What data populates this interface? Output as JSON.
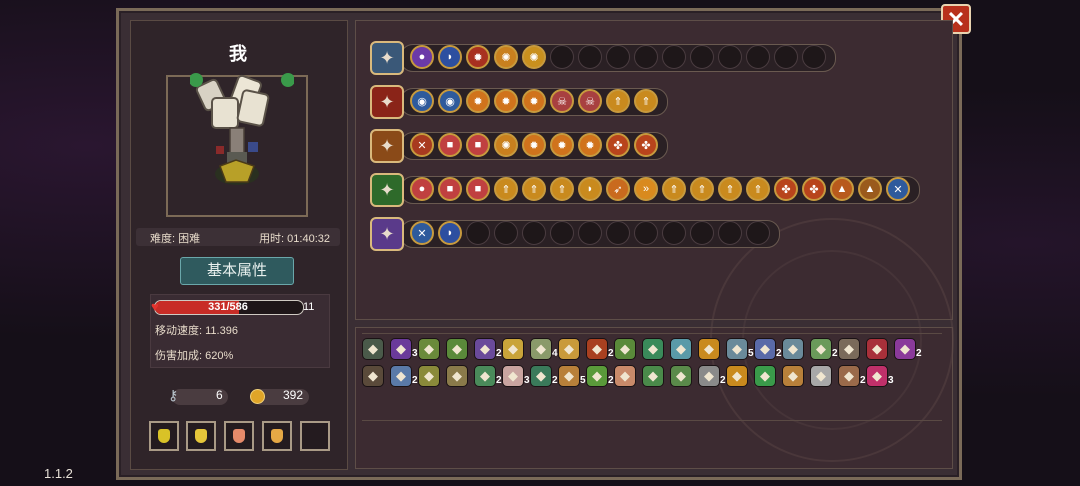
{
  "version": "1.1.2",
  "close_label": "✕",
  "player": {
    "name": "我",
    "difficulty_label": "难度: 困难",
    "time_label": "用时: 01:40:32"
  },
  "attributes_button": "基本属性",
  "stats": {
    "hp_text": "331/586",
    "hp_fraction": 0.565,
    "shield": "11",
    "move_speed": "移动速度: 11.396",
    "damage_bonus": "伤害加成: 620%"
  },
  "resources": {
    "keys": "6",
    "coins": "392"
  },
  "potions": [
    {
      "color": "#d9c227"
    },
    {
      "color": "#e6c63a"
    },
    {
      "color": "#e68a6a"
    },
    {
      "color": "#e6a845"
    },
    {
      "color": ""
    }
  ],
  "weapon_rows": [
    {
      "weapon_icon": "chest-weapon-icon",
      "weapon_color": "#3a5878",
      "slots": [
        {
          "icon": "purple-orb-icon",
          "color": "#6b3aa8",
          "glyph": "●"
        },
        {
          "icon": "wave-icon",
          "color": "#2d4fa0",
          "glyph": "◗"
        },
        {
          "icon": "bomb-icon",
          "color": "#a83020",
          "glyph": "✹"
        },
        {
          "icon": "gear-icon",
          "color": "#c9801e",
          "glyph": "✺"
        },
        {
          "icon": "gear-icon",
          "color": "#c9901e",
          "glyph": "✺"
        },
        {
          "icon": "",
          "color": "",
          "glyph": ""
        },
        {
          "icon": "",
          "color": "",
          "glyph": ""
        },
        {
          "icon": "",
          "color": "",
          "glyph": ""
        },
        {
          "icon": "",
          "color": "",
          "glyph": ""
        },
        {
          "icon": "",
          "color": "",
          "glyph": ""
        },
        {
          "icon": "",
          "color": "",
          "glyph": ""
        },
        {
          "icon": "",
          "color": "",
          "glyph": ""
        },
        {
          "icon": "",
          "color": "",
          "glyph": ""
        },
        {
          "icon": "",
          "color": "",
          "glyph": ""
        },
        {
          "icon": "",
          "color": "",
          "glyph": ""
        }
      ]
    },
    {
      "weapon_icon": "red-staff-icon",
      "weapon_color": "#8a2418",
      "slots": [
        {
          "icon": "eye-icon",
          "color": "#2e5a9c",
          "glyph": "◉"
        },
        {
          "icon": "eye-icon",
          "color": "#2e5a9c",
          "glyph": "◉"
        },
        {
          "icon": "sun-icon",
          "color": "#d0731c",
          "glyph": "✹"
        },
        {
          "icon": "sun-icon",
          "color": "#d0731c",
          "glyph": "✹"
        },
        {
          "icon": "sun-icon",
          "color": "#d0731c",
          "glyph": "✹"
        },
        {
          "icon": "skull-icon",
          "color": "#a84040",
          "glyph": "☠"
        },
        {
          "icon": "skull-icon",
          "color": "#a84040",
          "glyph": "☠"
        },
        {
          "icon": "arrow-up-icon",
          "color": "#c98a1e",
          "glyph": "⇑"
        },
        {
          "icon": "arrow-up-icon",
          "color": "#c98a1e",
          "glyph": "⇑"
        }
      ]
    },
    {
      "weapon_icon": "fire-staff-icon",
      "weapon_color": "#8a4a18",
      "slots": [
        {
          "icon": "bow-icon",
          "color": "#a83a20",
          "glyph": "✕"
        },
        {
          "icon": "box-icon",
          "color": "#c04040",
          "glyph": "■"
        },
        {
          "icon": "box-icon",
          "color": "#c04040",
          "glyph": "■"
        },
        {
          "icon": "gear-icon",
          "color": "#c9801e",
          "glyph": "✺"
        },
        {
          "icon": "sun-icon",
          "color": "#d0731c",
          "glyph": "✹"
        },
        {
          "icon": "sun-icon",
          "color": "#d0731c",
          "glyph": "✹"
        },
        {
          "icon": "sun-icon",
          "color": "#d0731c",
          "glyph": "✹"
        },
        {
          "icon": "triad-icon",
          "color": "#b8441c",
          "glyph": "✤"
        },
        {
          "icon": "triad-icon",
          "color": "#b8441c",
          "glyph": "✤"
        }
      ]
    },
    {
      "weapon_icon": "green-staff-icon",
      "weapon_color": "#2e6a2a",
      "slots": [
        {
          "icon": "orb-icon",
          "color": "#c04040",
          "glyph": "●"
        },
        {
          "icon": "box-icon",
          "color": "#c04040",
          "glyph": "■"
        },
        {
          "icon": "box-icon",
          "color": "#c04040",
          "glyph": "■"
        },
        {
          "icon": "arrow-up-icon",
          "color": "#c98a1e",
          "glyph": "⇑"
        },
        {
          "icon": "arrow-up-icon",
          "color": "#c98a1e",
          "glyph": "⇑"
        },
        {
          "icon": "arrow-up-icon",
          "color": "#c98a1e",
          "glyph": "⇑"
        },
        {
          "icon": "crescent-icon",
          "color": "#c98a1e",
          "glyph": "◗"
        },
        {
          "icon": "arrow-icon",
          "color": "#c96a1e",
          "glyph": "➶"
        },
        {
          "icon": "chevron-icon",
          "color": "#d98a1e",
          "glyph": "»"
        },
        {
          "icon": "arrow-up-icon",
          "color": "#c98a1e",
          "glyph": "⇑"
        },
        {
          "icon": "arrow-up-icon",
          "color": "#c98a1e",
          "glyph": "⇑"
        },
        {
          "icon": "arrow-up-icon",
          "color": "#c98a1e",
          "glyph": "⇑"
        },
        {
          "icon": "arrow-up-icon",
          "color": "#c98a1e",
          "glyph": "⇑"
        },
        {
          "icon": "triad-icon",
          "color": "#b8441c",
          "glyph": "✤"
        },
        {
          "icon": "triad-icon",
          "color": "#b8441c",
          "glyph": "✤"
        },
        {
          "icon": "flame-icon",
          "color": "#b85a1c",
          "glyph": "▲"
        },
        {
          "icon": "flame-icon",
          "color": "#9a5a1c",
          "glyph": "▲"
        },
        {
          "icon": "sword-cross-icon",
          "color": "#2e5a9c",
          "glyph": "✕"
        }
      ]
    },
    {
      "weapon_icon": "purple-staff-icon",
      "weapon_color": "#5a3a8a",
      "slots": [
        {
          "icon": "sword-cross-icon",
          "color": "#2e5a9c",
          "glyph": "✕"
        },
        {
          "icon": "wave-icon",
          "color": "#2d4fa0",
          "glyph": "◗"
        },
        {
          "icon": "",
          "color": "",
          "glyph": ""
        },
        {
          "icon": "",
          "color": "",
          "glyph": ""
        },
        {
          "icon": "",
          "color": "",
          "glyph": ""
        },
        {
          "icon": "",
          "color": "",
          "glyph": ""
        },
        {
          "icon": "",
          "color": "",
          "glyph": ""
        },
        {
          "icon": "",
          "color": "",
          "glyph": ""
        },
        {
          "icon": "",
          "color": "",
          "glyph": ""
        },
        {
          "icon": "",
          "color": "",
          "glyph": ""
        },
        {
          "icon": "",
          "color": "",
          "glyph": ""
        },
        {
          "icon": "",
          "color": "",
          "glyph": ""
        },
        {
          "icon": "",
          "color": "",
          "glyph": ""
        }
      ]
    }
  ],
  "items_row1": [
    {
      "icon": "mask-icon",
      "color": "#4a5a4a",
      "count": ""
    },
    {
      "icon": "witch-hat-icon",
      "color": "#6a3a9a",
      "count": "3"
    },
    {
      "icon": "map-icon",
      "color": "#6a8a3a",
      "count": ""
    },
    {
      "icon": "scroll-icon",
      "color": "#5a8a3a",
      "count": ""
    },
    {
      "icon": "robe-icon",
      "color": "#6a4a9a",
      "count": "2"
    },
    {
      "icon": "horn-icon",
      "color": "#c9a43a",
      "count": ""
    },
    {
      "icon": "chain-icon",
      "color": "#8a9a6a",
      "count": "4"
    },
    {
      "icon": "crystal-icon",
      "color": "#c99a3a",
      "count": ""
    },
    {
      "icon": "helmet-icon",
      "color": "#a84020",
      "count": "2"
    },
    {
      "icon": "staff-icon",
      "color": "#5a8a3a",
      "count": ""
    },
    {
      "icon": "bottle-icon",
      "color": "#3a8a5a",
      "count": ""
    },
    {
      "icon": "compass-icon",
      "color": "#5a9aa8",
      "count": ""
    },
    {
      "icon": "book-icon",
      "color": "#c98a1e",
      "count": ""
    },
    {
      "icon": "wrench-icon",
      "color": "#6a8a9a",
      "count": "5"
    },
    {
      "icon": "feather-icon",
      "color": "#5a6aa8",
      "count": "2"
    },
    {
      "icon": "shield-icon",
      "color": "#6a8a9a",
      "count": ""
    },
    {
      "icon": "hook-icon",
      "color": "#6a9a5a",
      "count": "2"
    },
    {
      "icon": "cape-icon",
      "color": "#7a6a5a",
      "count": ""
    },
    {
      "icon": "capsule-icon",
      "color": "#a8303a",
      "count": ""
    },
    {
      "icon": "hat-icon",
      "color": "#8a3a9a",
      "count": "2"
    }
  ],
  "items_row2": [
    {
      "icon": "cloak-icon",
      "color": "#5a4a3a",
      "count": ""
    },
    {
      "icon": "egg-icon",
      "color": "#5a7aa8",
      "count": "2"
    },
    {
      "icon": "lantern-icon",
      "color": "#8a8a3a",
      "count": ""
    },
    {
      "icon": "scroll-icon",
      "color": "#8a7a4a",
      "count": ""
    },
    {
      "icon": "hat-icon",
      "color": "#4a8a5a",
      "count": "2"
    },
    {
      "icon": "feather-icon",
      "color": "#c9a4a0",
      "count": "3"
    },
    {
      "icon": "boot-icon",
      "color": "#3a7a5a",
      "count": "2"
    },
    {
      "icon": "hammer-icon",
      "color": "#b8803a",
      "count": "5"
    },
    {
      "icon": "leaf-icon",
      "color": "#5a9a3a",
      "count": "2"
    },
    {
      "icon": "ring-icon",
      "color": "#c98a6a",
      "count": ""
    },
    {
      "icon": "wing-icon",
      "color": "#4a8a4a",
      "count": ""
    },
    {
      "icon": "plant-icon",
      "color": "#5a8a4a",
      "count": ""
    },
    {
      "icon": "wrench-icon",
      "color": "#8a8a8a",
      "count": "2"
    },
    {
      "icon": "glove-icon",
      "color": "#c98a1e",
      "count": ""
    },
    {
      "icon": "clover-icon",
      "color": "#3a9a4a",
      "count": ""
    },
    {
      "icon": "bag-icon",
      "color": "#b8803a",
      "count": ""
    },
    {
      "icon": "trident-icon",
      "color": "#a8a8a8",
      "count": ""
    },
    {
      "icon": "arm-icon",
      "color": "#9a6a4a",
      "count": "2"
    },
    {
      "icon": "eye-icon",
      "color": "#c0306a",
      "count": "3"
    }
  ]
}
